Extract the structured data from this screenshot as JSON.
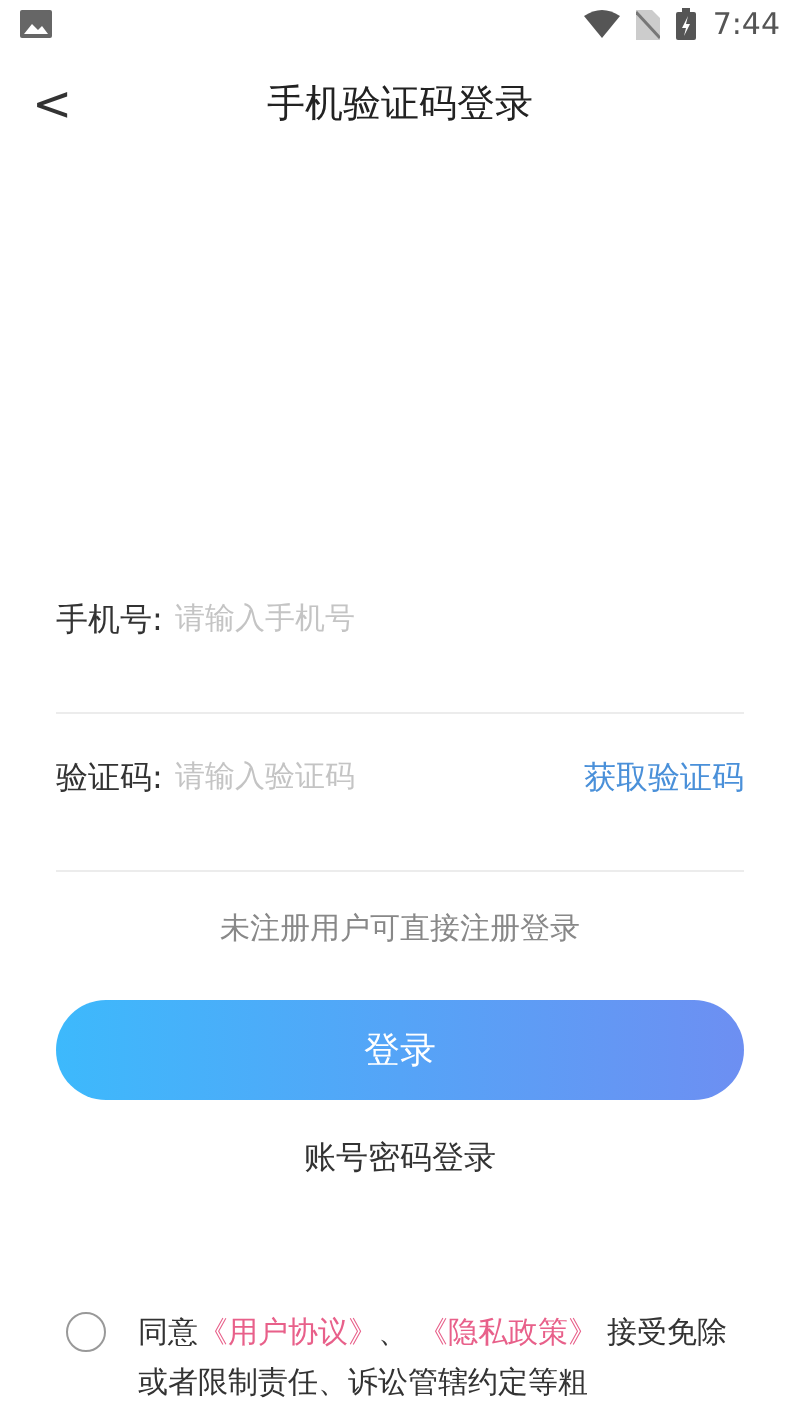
{
  "status_bar": {
    "time": "7:44"
  },
  "header": {
    "back": "<",
    "title": "手机验证码登录"
  },
  "fields": [
    {
      "label": "手机号:",
      "placeholder": "请输入手机号"
    },
    {
      "label": "验证码:",
      "placeholder": "请输入验证码",
      "action": "获取验证码"
    }
  ],
  "hint": "未注册用户可直接注册登录",
  "login_button": "登录",
  "alt_login": "账号密码登录",
  "agreement": {
    "checked": false,
    "prefix": "同意",
    "links": [
      "《用户协议》",
      "《隐私政策》"
    ],
    "separator": "、",
    "rest": "接受免除或者限制责任、诉讼管辖约定等粗"
  }
}
